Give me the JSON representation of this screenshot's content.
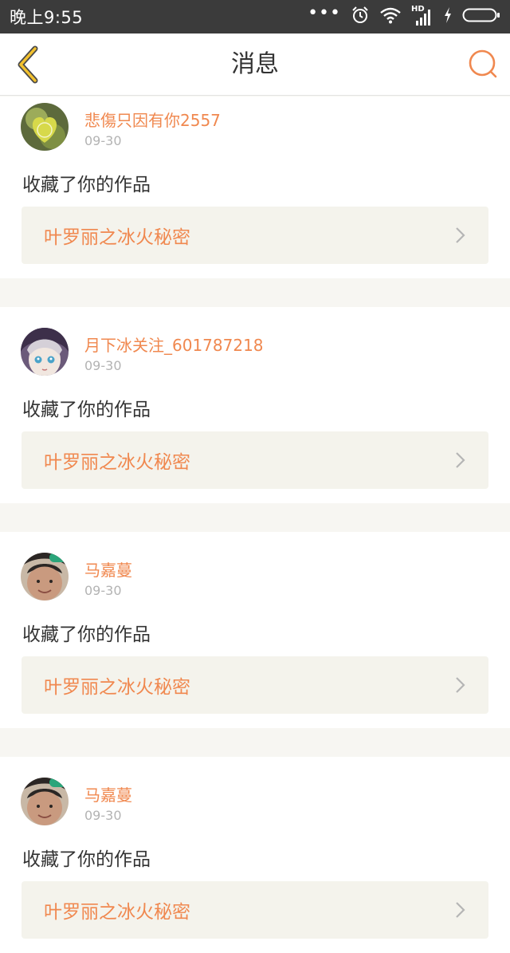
{
  "status_bar": {
    "time": "晚上9:55",
    "icons": [
      "more-dots-icon",
      "alarm-icon",
      "wifi-icon",
      "hd-signal-icon",
      "charging-icon",
      "battery-icon"
    ],
    "hd_label": "HD"
  },
  "header": {
    "title": "消息",
    "back_icon": "chevron-left-icon",
    "search_icon": "search-icon",
    "accent_color": "#f0884f",
    "back_color": "#f2c12e"
  },
  "messages": [
    {
      "username": "悲傷只因有你2557",
      "date": "09-30",
      "action": "收藏了你的作品",
      "work_title": "叶罗丽之冰火秘密",
      "avatar": "avatar-heart"
    },
    {
      "username": "月下冰关注_601787218",
      "date": "09-30",
      "action": "收藏了你的作品",
      "work_title": "叶罗丽之冰火秘密",
      "avatar": "avatar-anime"
    },
    {
      "username": "马嘉蔓",
      "date": "09-30",
      "action": "收藏了你的作品",
      "work_title": "叶罗丽之冰火秘密",
      "avatar": "avatar-photo"
    },
    {
      "username": "马嘉蔓",
      "date": "09-30",
      "action": "收藏了你的作品",
      "work_title": "叶罗丽之冰火秘密",
      "avatar": "avatar-photo"
    }
  ]
}
